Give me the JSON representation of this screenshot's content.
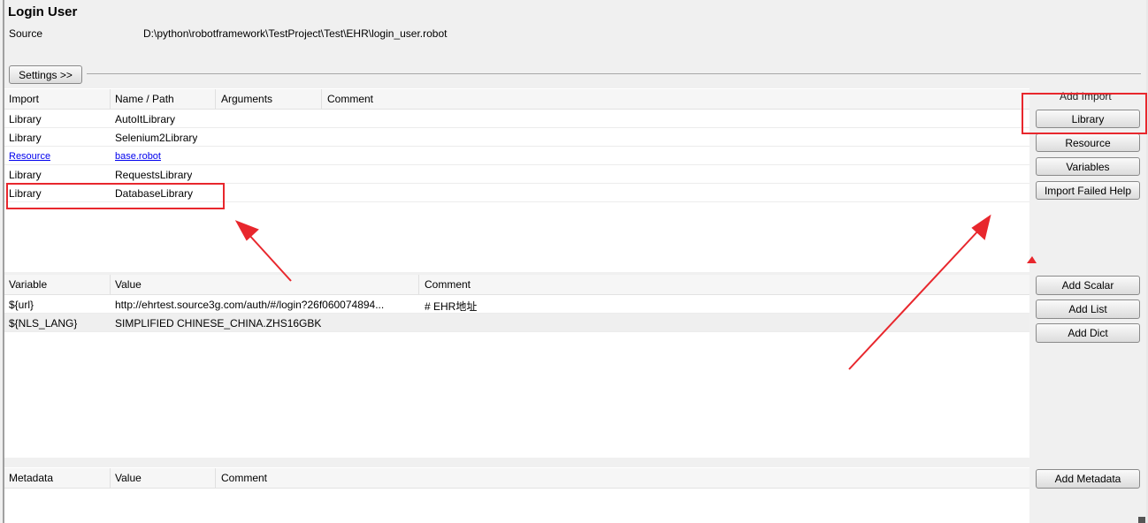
{
  "header": {
    "title": "Login User",
    "source_label": "Source",
    "source_path": "D:\\python\\robotframework\\TestProject\\Test\\EHR\\login_user.robot"
  },
  "settings_button": "Settings >>",
  "imports": {
    "columns": [
      "Import",
      "Name / Path",
      "Arguments",
      "Comment"
    ],
    "rows": [
      {
        "type": "Library",
        "name": "AutoItLibrary"
      },
      {
        "type": "Library",
        "name": "Selenium2Library"
      },
      {
        "type": "Resource",
        "name": "base.robot"
      },
      {
        "type": "Library",
        "name": "RequestsLibrary"
      },
      {
        "type": "Library",
        "name": "DatabaseLibrary"
      }
    ]
  },
  "import_panel": {
    "label": "Add Import",
    "buttons": [
      "Library",
      "Resource",
      "Variables",
      "Import Failed Help"
    ]
  },
  "variables": {
    "columns": [
      "Variable",
      "Value",
      "Comment"
    ],
    "rows": [
      {
        "name": "${url}",
        "value": "http://ehrtest.source3g.com/auth/#/login?26f060074894...",
        "comment": "# EHR地址"
      },
      {
        "name": "${NLS_LANG}",
        "value": "SIMPLIFIED CHINESE_CHINA.ZHS16GBK",
        "comment": ""
      }
    ]
  },
  "variable_buttons": [
    "Add Scalar",
    "Add List",
    "Add Dict"
  ],
  "metadata": {
    "columns": [
      "Metadata",
      "Value",
      "Comment"
    ]
  },
  "metadata_button": "Add Metadata",
  "colors": {
    "annotation_red": "#e8272d",
    "link_blue": "#0000ee"
  }
}
